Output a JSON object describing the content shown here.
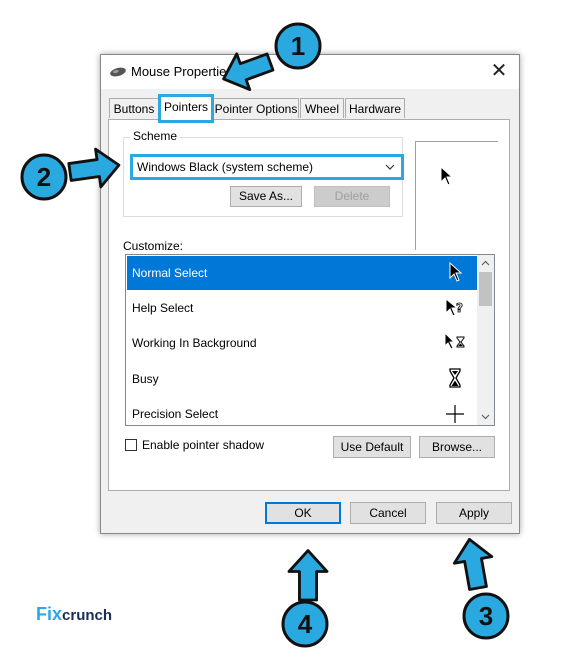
{
  "window": {
    "title": "Mouse Properties",
    "close_glyph": "✕"
  },
  "tabs": [
    {
      "label": "Buttons"
    },
    {
      "label": "Pointers"
    },
    {
      "label": "Pointer Options"
    },
    {
      "label": "Wheel"
    },
    {
      "label": "Hardware"
    }
  ],
  "active_tab": "Pointers",
  "scheme": {
    "group_label": "Scheme",
    "selected": "Windows Black (system scheme)",
    "save_as_label": "Save As...",
    "delete_label": "Delete"
  },
  "customize": {
    "label": "Customize:",
    "items": [
      {
        "label": "Normal Select",
        "icon": "arrow-cursor-icon",
        "selected": true
      },
      {
        "label": "Help Select",
        "icon": "help-cursor-icon",
        "selected": false
      },
      {
        "label": "Working In Background",
        "icon": "working-cursor-icon",
        "selected": false
      },
      {
        "label": "Busy",
        "icon": "hourglass-cursor-icon",
        "selected": false
      },
      {
        "label": "Precision Select",
        "icon": "crosshair-cursor-icon",
        "selected": false
      }
    ]
  },
  "shadow": {
    "label": "Enable pointer shadow",
    "checked": false
  },
  "buttons": {
    "use_default": "Use Default",
    "browse": "Browse...",
    "ok": "OK",
    "cancel": "Cancel",
    "apply": "Apply"
  },
  "annotations": {
    "step1": "1",
    "step2": "2",
    "step3": "3",
    "step4": "4",
    "color": "#2aa9e0"
  },
  "logo": {
    "fix": "Fix",
    "crunch": "crunch"
  }
}
